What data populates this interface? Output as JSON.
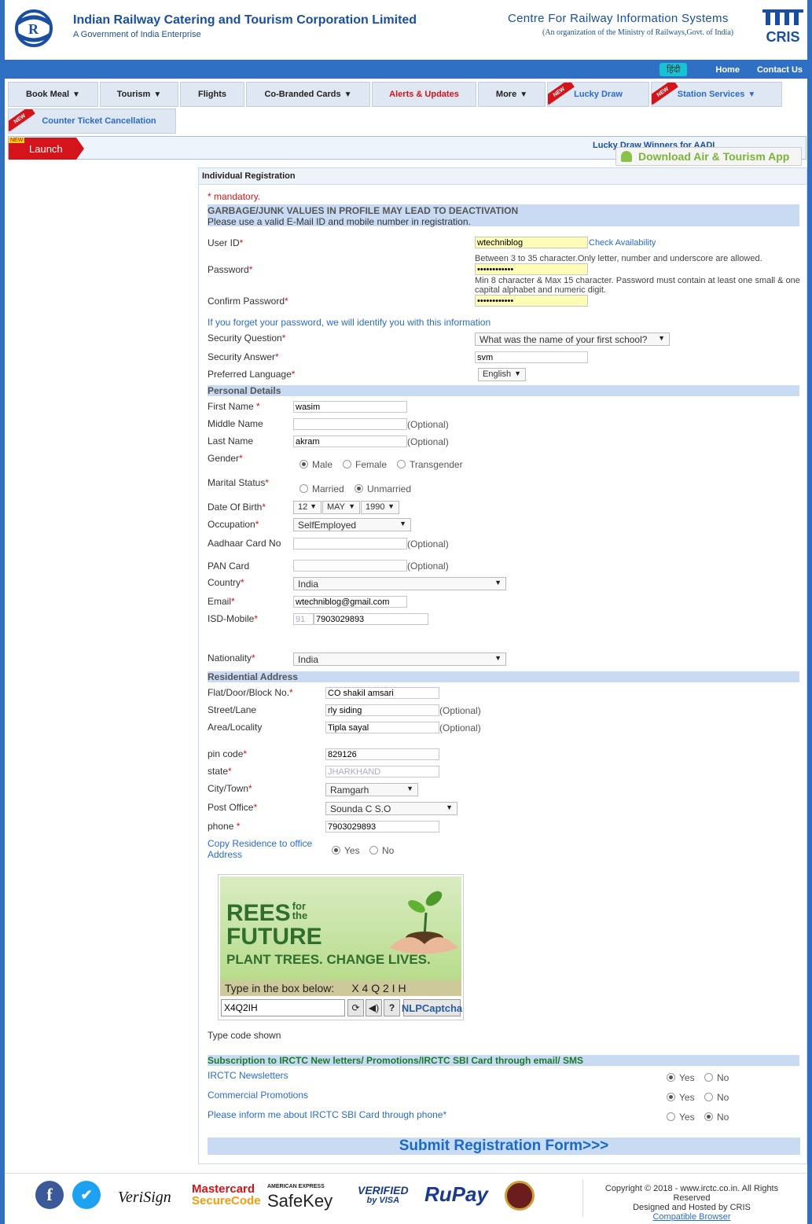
{
  "header": {
    "org_title": "Indian Railway Catering and Tourism Corporation Limited",
    "org_sub": "A Government of India Enterprise",
    "cris_title": "Centre For Railway Information Systems",
    "cris_sub": "(An organization of the Ministry of Railways,Govt. of India)",
    "cris_logo_text": "CRIS",
    "hindi": "हिंदी",
    "home": "Home",
    "contact": "Contact Us"
  },
  "nav": {
    "book_meal": "Book Meal",
    "tourism": "Tourism",
    "flights": "Flights",
    "cobranded": "Co-Branded Cards",
    "alerts": "Alerts & Updates",
    "more": "More",
    "lucky_draw": "Lucky Draw",
    "station_services": "Station Services",
    "counter_ticket": "Counter Ticket Cancellation",
    "new_badge": "NEW"
  },
  "launch": {
    "label": "Launch",
    "new": "NEW",
    "marquee": "Lucky Draw Winners for AADI",
    "app": "Download Air & Tourism App"
  },
  "form": {
    "heading": "Individual Registration",
    "mandatory": "* mandatory.",
    "warning": "GARBAGE/JUNK VALUES IN PROFILE MAY LEAD TO DEACTIVATION",
    "warning_sub": "Please use a valid E-Mail ID and mobile number in registration.",
    "user_id_label": "User ID",
    "user_id": "wtechniblog",
    "check": "Check Availability",
    "user_hint": "Between 3 to 35 character.Only letter, number and underscore are allowed.",
    "password_label": "Password",
    "password": "••••••••••••",
    "password_hint": "Min 8 character & Max 15 character. Password must contain at least one small & one capital alphabet and numeric digit.",
    "confirm_label": "Confirm Password",
    "confirm": "••••••••••••",
    "forget_note": "If you forget your password, we will identify you with this information",
    "sq_label": "Security Question",
    "sq": "What was the name of your first school?",
    "sa_label": "Security Answer",
    "sa": "svm",
    "lang_label": "Preferred Language",
    "lang": "English",
    "personal": "Personal Details",
    "first_label": "First Name",
    "first": "wasim",
    "middle_label": "Middle Name",
    "middle": "",
    "last_label": "Last Name",
    "last": "akram",
    "optional": "(Optional)",
    "gender_label": "Gender",
    "male": "Male",
    "female": "Female",
    "trans": "Transgender",
    "marital_label": "Marital Status",
    "married": "Married",
    "unmarried": "Unmarried",
    "dob_label": "Date Of Birth",
    "dob_day": "12",
    "dob_month": "MAY",
    "dob_year": "1990",
    "occ_label": "Occupation",
    "occ": "SelfEmployed",
    "aadhaar_label": "Aadhaar Card No",
    "pan_label": "PAN Card",
    "country_label": "Country",
    "country": "India",
    "email_label": "Email",
    "email": "wtechniblog@gmail.com",
    "isd_label": "ISD-Mobile",
    "isd": "91",
    "mobile": "7903029893",
    "nationality_label": "Nationality",
    "nationality": "India",
    "residential": "Residential Address",
    "flat_label": "Flat/Door/Block No.",
    "flat": "CO shakil amsari",
    "street_label": "Street/Lane",
    "street": "rly siding",
    "area_label": "Area/Locality",
    "area": "Tipla sayal",
    "pin_label": "pin code",
    "pin": "829126",
    "state_label": "state",
    "state": "JHARKHAND",
    "city_label": "City/Town",
    "city": "Ramgarh",
    "po_label": "Post Office",
    "po": "Sounda C S.O",
    "phone_label": "phone",
    "phone": "7903029893",
    "copy_label": "Copy Residence to office Address",
    "yes": "Yes",
    "no": "No",
    "type_code": "Type code shown",
    "subs": "Subscription to IRCTC New letters/ Promotions/IRCTC SBI Card through email/ SMS",
    "newsletters": "IRCTC Newsletters",
    "commercial": "Commercial Promotions",
    "sbi": "Please inform me about IRCTC SBI Card through phone*",
    "submit": "Submit Registration Form>>>"
  },
  "captcha": {
    "line1": "REES",
    "line1b": "for the",
    "line2": "FUTURE",
    "line3": "PLANT TREES. CHANGE LIVES.",
    "strip": "Type in the box below:",
    "code": "X 4 Q 2 I H",
    "value": "X4Q2IH",
    "nlp": "NLPCaptcha"
  },
  "footer": {
    "verisign": "VeriSign",
    "mastercard": "Mastercard",
    "securecode": "SecureCode",
    "amex": "AMERICAN EXPRESS",
    "safekey": "SafeKey",
    "verified": "VERIFIED",
    "byvisa": "by VISA",
    "rupay": "RuPay",
    "copyright": "Copyright © 2018 - www.irctc.co.in. All Rights Reserved",
    "hosted": "Designed and Hosted by CRIS",
    "compatible": "Compatible Browser"
  }
}
